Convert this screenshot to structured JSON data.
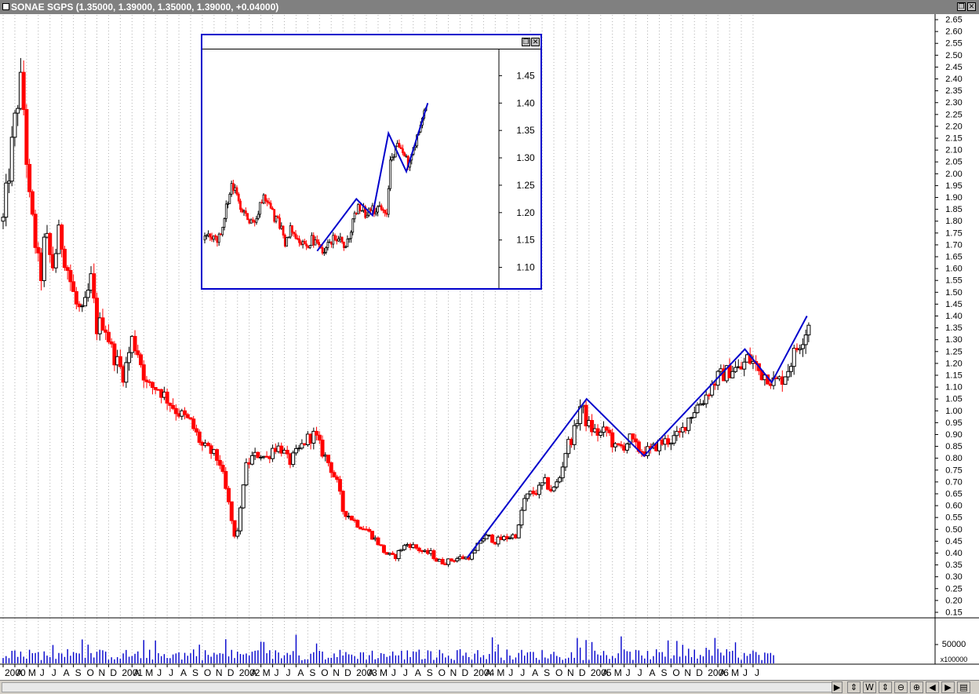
{
  "window": {
    "title": "SONAE SGPS (1.35000, 1.39000, 1.35000, 1.39000, +0.04000)"
  },
  "volume_unit_label": "x100000",
  "controls": {
    "scroll_right": "▶",
    "tool_labels": [
      "⇕",
      "W",
      "⇕",
      "⊖",
      "⊕",
      "◀",
      "▶",
      "▤"
    ]
  },
  "colors": {
    "up": "#000000",
    "down": "#ff0000",
    "trend": "#0000cc",
    "volume": "#0000cc",
    "grid": "#b0b0b0"
  },
  "chart_data": [
    {
      "type": "candlestick",
      "title": "SONAE SGPS",
      "ylim": [
        0.13,
        2.67
      ],
      "yscale": "linear",
      "y_ticks": [
        0.15,
        0.2,
        0.25,
        0.3,
        0.35,
        0.4,
        0.45,
        0.5,
        0.55,
        0.6,
        0.65,
        0.7,
        0.75,
        0.8,
        0.85,
        0.9,
        0.95,
        1.0,
        1.05,
        1.1,
        1.15,
        1.2,
        1.25,
        1.3,
        1.35,
        1.4,
        1.45,
        1.5,
        1.55,
        1.6,
        1.65,
        1.7,
        1.75,
        1.8,
        1.85,
        1.9,
        1.95,
        2.0,
        2.05,
        2.1,
        2.15,
        2.2,
        2.25,
        2.3,
        2.35,
        2.4,
        2.45,
        2.5,
        2.55,
        2.6,
        2.65
      ],
      "x_month_labels": [
        "2000",
        "A",
        "M",
        "J",
        "J",
        "A",
        "S",
        "O",
        "N",
        "D",
        "2001",
        "A",
        "M",
        "J",
        "J",
        "A",
        "S",
        "O",
        "N",
        "D",
        "2002",
        "A",
        "M",
        "J",
        "J",
        "A",
        "S",
        "O",
        "N",
        "D",
        "2003",
        "A",
        "M",
        "J",
        "J",
        "A",
        "S",
        "O",
        "N",
        "D",
        "2004",
        "A",
        "M",
        "J",
        "J",
        "A",
        "S",
        "O",
        "N",
        "D",
        "2005",
        "A",
        "M",
        "J",
        "J",
        "A",
        "S",
        "O",
        "N",
        "D",
        "2006",
        "A",
        "M",
        "J",
        "J"
      ],
      "x_months_domain": [
        0,
        79
      ],
      "price_path": [
        [
          0,
          1.8
        ],
        [
          1.2,
          2.3
        ],
        [
          1.6,
          2.4
        ],
        [
          2.2,
          1.9
        ],
        [
          3.2,
          1.55
        ],
        [
          3.6,
          1.75
        ],
        [
          4.2,
          1.6
        ],
        [
          4.8,
          1.75
        ],
        [
          5.5,
          1.6
        ],
        [
          6.2,
          1.45
        ],
        [
          6.8,
          1.4
        ],
        [
          7.5,
          1.55
        ],
        [
          8,
          1.35
        ],
        [
          8.6,
          1.38
        ],
        [
          9.3,
          1.25
        ],
        [
          10.3,
          1.15
        ],
        [
          11,
          1.3
        ],
        [
          11.5,
          1.25
        ],
        [
          12.3,
          1.1
        ],
        [
          13.2,
          1.1
        ],
        [
          14.8,
          1.0
        ],
        [
          16,
          0.95
        ],
        [
          17,
          0.85
        ],
        [
          17.9,
          0.82
        ],
        [
          18.5,
          0.78
        ],
        [
          19.2,
          0.62
        ],
        [
          19.8,
          0.45
        ],
        [
          20.2,
          0.55
        ],
        [
          20.6,
          0.75
        ],
        [
          21.2,
          0.8
        ],
        [
          21.9,
          0.82
        ],
        [
          22.5,
          0.8
        ],
        [
          23.1,
          0.85
        ],
        [
          23.8,
          0.84
        ],
        [
          24.4,
          0.78
        ],
        [
          25.2,
          0.83
        ],
        [
          25.9,
          0.88
        ],
        [
          26.6,
          0.9
        ],
        [
          27.1,
          0.84
        ],
        [
          27.9,
          0.77
        ],
        [
          28.6,
          0.68
        ],
        [
          29,
          0.58
        ],
        [
          29.7,
          0.55
        ],
        [
          30.3,
          0.52
        ],
        [
          31,
          0.5
        ],
        [
          31.9,
          0.45
        ],
        [
          32.6,
          0.4
        ],
        [
          33.4,
          0.38
        ],
        [
          34,
          0.42
        ],
        [
          34.6,
          0.44
        ],
        [
          35.3,
          0.42
        ],
        [
          36,
          0.4
        ],
        [
          36.5,
          0.4
        ],
        [
          37,
          0.37
        ],
        [
          37.6,
          0.36
        ],
        [
          38.2,
          0.37
        ],
        [
          39,
          0.38
        ],
        [
          39.6,
          0.38
        ],
        [
          40.2,
          0.4
        ],
        [
          40.8,
          0.46
        ],
        [
          41.4,
          0.47
        ],
        [
          42,
          0.45
        ],
        [
          42.6,
          0.46
        ],
        [
          43.3,
          0.47
        ],
        [
          43.9,
          0.48
        ],
        [
          44.4,
          0.62
        ],
        [
          45,
          0.65
        ],
        [
          45.6,
          0.66
        ],
        [
          46.2,
          0.7
        ],
        [
          46.9,
          0.66
        ],
        [
          47.5,
          0.72
        ],
        [
          48.1,
          0.85
        ],
        [
          48.7,
          0.9
        ],
        [
          49.3,
          1.03
        ],
        [
          49.8,
          0.95
        ],
        [
          50.3,
          0.92
        ],
        [
          50.9,
          0.9
        ],
        [
          51.6,
          0.92
        ],
        [
          52.2,
          0.84
        ],
        [
          52.9,
          0.85
        ],
        [
          53.5,
          0.88
        ],
        [
          54.1,
          0.84
        ],
        [
          54.7,
          0.83
        ],
        [
          55.3,
          0.83
        ],
        [
          55.9,
          0.86
        ],
        [
          56.5,
          0.87
        ],
        [
          57.1,
          0.88
        ],
        [
          57.8,
          0.9
        ],
        [
          58.5,
          0.97
        ],
        [
          59.2,
          1.02
        ],
        [
          59.8,
          1.05
        ],
        [
          60.4,
          1.1
        ],
        [
          61,
          1.14
        ],
        [
          61.7,
          1.16
        ],
        [
          62.3,
          1.18
        ],
        [
          62.9,
          1.17
        ],
        [
          63.5,
          1.22
        ],
        [
          64.1,
          1.2
        ],
        [
          64.6,
          1.16
        ],
        [
          65.2,
          1.15
        ],
        [
          65.8,
          1.12
        ],
        [
          66.4,
          1.13
        ],
        [
          67,
          1.18
        ],
        [
          67.6,
          1.25
        ],
        [
          68.1,
          1.3
        ],
        [
          68.6,
          1.35
        ],
        [
          68.9,
          1.39
        ]
      ],
      "volume_ticks": [
        "50000"
      ],
      "trendline": [
        [
          39.6,
          0.38
        ],
        [
          49.8,
          1.05
        ],
        [
          54.7,
          0.81
        ],
        [
          63.3,
          1.26
        ],
        [
          65.6,
          1.12
        ],
        [
          68.6,
          1.4
        ]
      ]
    },
    {
      "type": "candlestick",
      "title": "inset",
      "ylim": [
        1.065,
        1.495
      ],
      "y_ticks": [
        1.1,
        1.15,
        1.2,
        1.25,
        1.3,
        1.35,
        1.4,
        1.45
      ],
      "x_days_domain": [
        0,
        124
      ],
      "price_path": [
        [
          0,
          1.15
        ],
        [
          3,
          1.16
        ],
        [
          6,
          1.15
        ],
        [
          9,
          1.16
        ],
        [
          12,
          1.21
        ],
        [
          15,
          1.25
        ],
        [
          18,
          1.23
        ],
        [
          21,
          1.2
        ],
        [
          24,
          1.19
        ],
        [
          27,
          1.18
        ],
        [
          30,
          1.2
        ],
        [
          33,
          1.23
        ],
        [
          36,
          1.22
        ],
        [
          39,
          1.19
        ],
        [
          42,
          1.18
        ],
        [
          45,
          1.14
        ],
        [
          48,
          1.17
        ],
        [
          51,
          1.16
        ],
        [
          54,
          1.15
        ],
        [
          57,
          1.14
        ],
        [
          60,
          1.15
        ],
        [
          63,
          1.14
        ],
        [
          66,
          1.13
        ],
        [
          69,
          1.14
        ],
        [
          72,
          1.15
        ],
        [
          75,
          1.16
        ],
        [
          78,
          1.14
        ],
        [
          81,
          1.15
        ],
        [
          84,
          1.2
        ],
        [
          87,
          1.21
        ],
        [
          90,
          1.2
        ],
        [
          93,
          1.21
        ],
        [
          96,
          1.2
        ],
        [
          99,
          1.21
        ],
        [
          102,
          1.2
        ],
        [
          104,
          1.3
        ],
        [
          106,
          1.31
        ],
        [
          108,
          1.33
        ],
        [
          110,
          1.31
        ],
        [
          112,
          1.3
        ],
        [
          114,
          1.29
        ],
        [
          116,
          1.3
        ],
        [
          118,
          1.33
        ],
        [
          120,
          1.35
        ],
        [
          122,
          1.37
        ],
        [
          124,
          1.39
        ]
      ],
      "trendline": [
        [
          63,
          1.13
        ],
        [
          85,
          1.225
        ],
        [
          94,
          1.195
        ],
        [
          103,
          1.345
        ],
        [
          113,
          1.275
        ],
        [
          125,
          1.4
        ]
      ]
    }
  ]
}
